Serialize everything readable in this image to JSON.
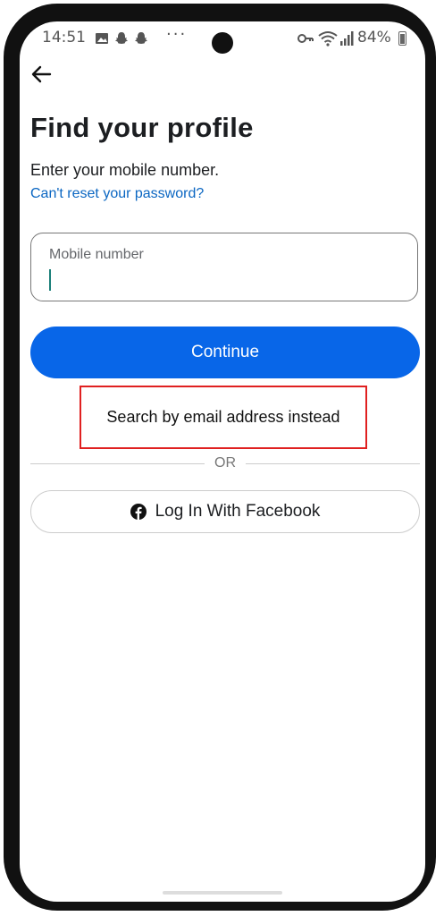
{
  "status_bar": {
    "time": "14:51",
    "left_icons": [
      "image-icon",
      "snapchat-icon",
      "snapchat-icon"
    ],
    "more": "···",
    "right_icons": [
      "key-icon",
      "wifi-icon",
      "signal-icon"
    ],
    "battery": "84%"
  },
  "header": {
    "back_icon": "arrow-left-icon"
  },
  "page": {
    "title": "Find your profile",
    "subtitle": "Enter your mobile number.",
    "reset_link": "Can't reset your password?"
  },
  "form": {
    "mobile_label": "Mobile number",
    "mobile_value": ""
  },
  "actions": {
    "continue_label": "Continue",
    "email_instead_label": "Search by email address instead",
    "or_label": "OR",
    "facebook_label": "Log In With Facebook"
  },
  "colors": {
    "primary": "#0866e8",
    "link": "#0a66c2",
    "highlight_border": "#e02020",
    "caret": "#1b7f79"
  }
}
